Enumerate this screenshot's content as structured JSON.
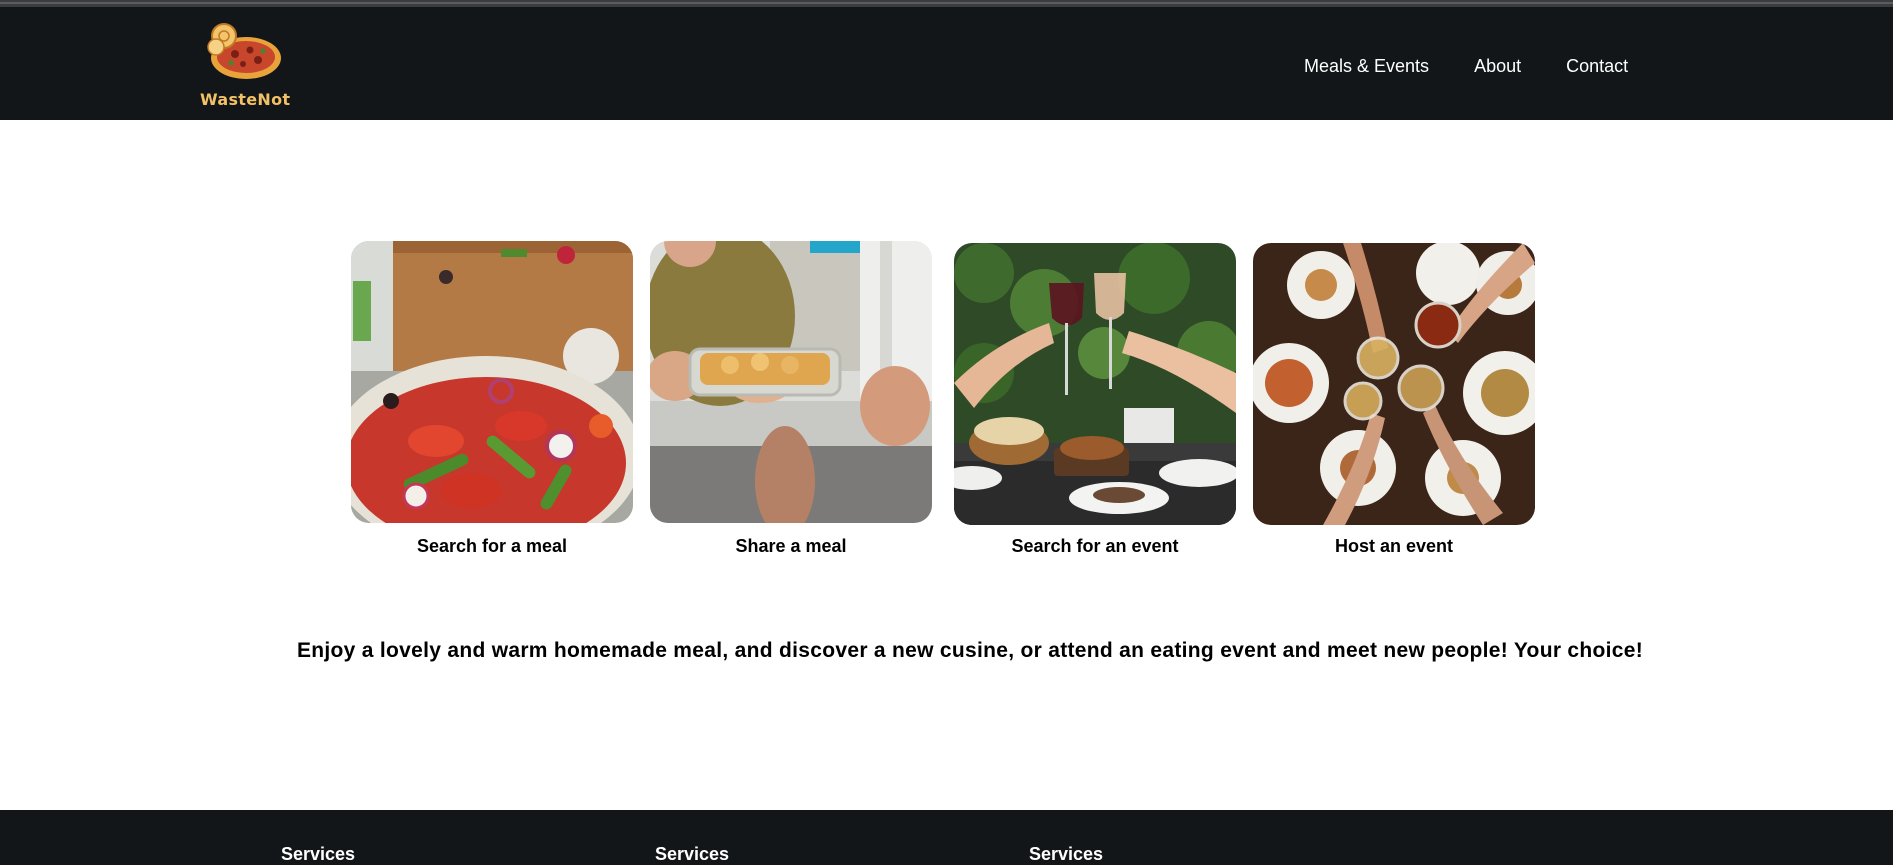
{
  "header": {
    "logo_text": "WasteNot",
    "nav": [
      "Meals & Events",
      "About",
      "Contact"
    ]
  },
  "cards": [
    {
      "label": "Search for a meal",
      "image": "salad-bowl-photo"
    },
    {
      "label": "Share a meal",
      "image": "sharing-dish-photo"
    },
    {
      "label": "Search for an event",
      "image": "wine-toast-photo"
    },
    {
      "label": "Host an event",
      "image": "dinner-table-toast-photo"
    }
  ],
  "tagline": "Enjoy a lovely and warm homemade meal, and discover a new cusine, or attend an eating event and meet new people! Your choice!",
  "footer": {
    "columns": [
      "Services",
      "Services",
      "Services"
    ]
  },
  "colors": {
    "header_bg": "#121619",
    "logo_gold": "#f2c165",
    "page_bg": "#ffffff"
  }
}
